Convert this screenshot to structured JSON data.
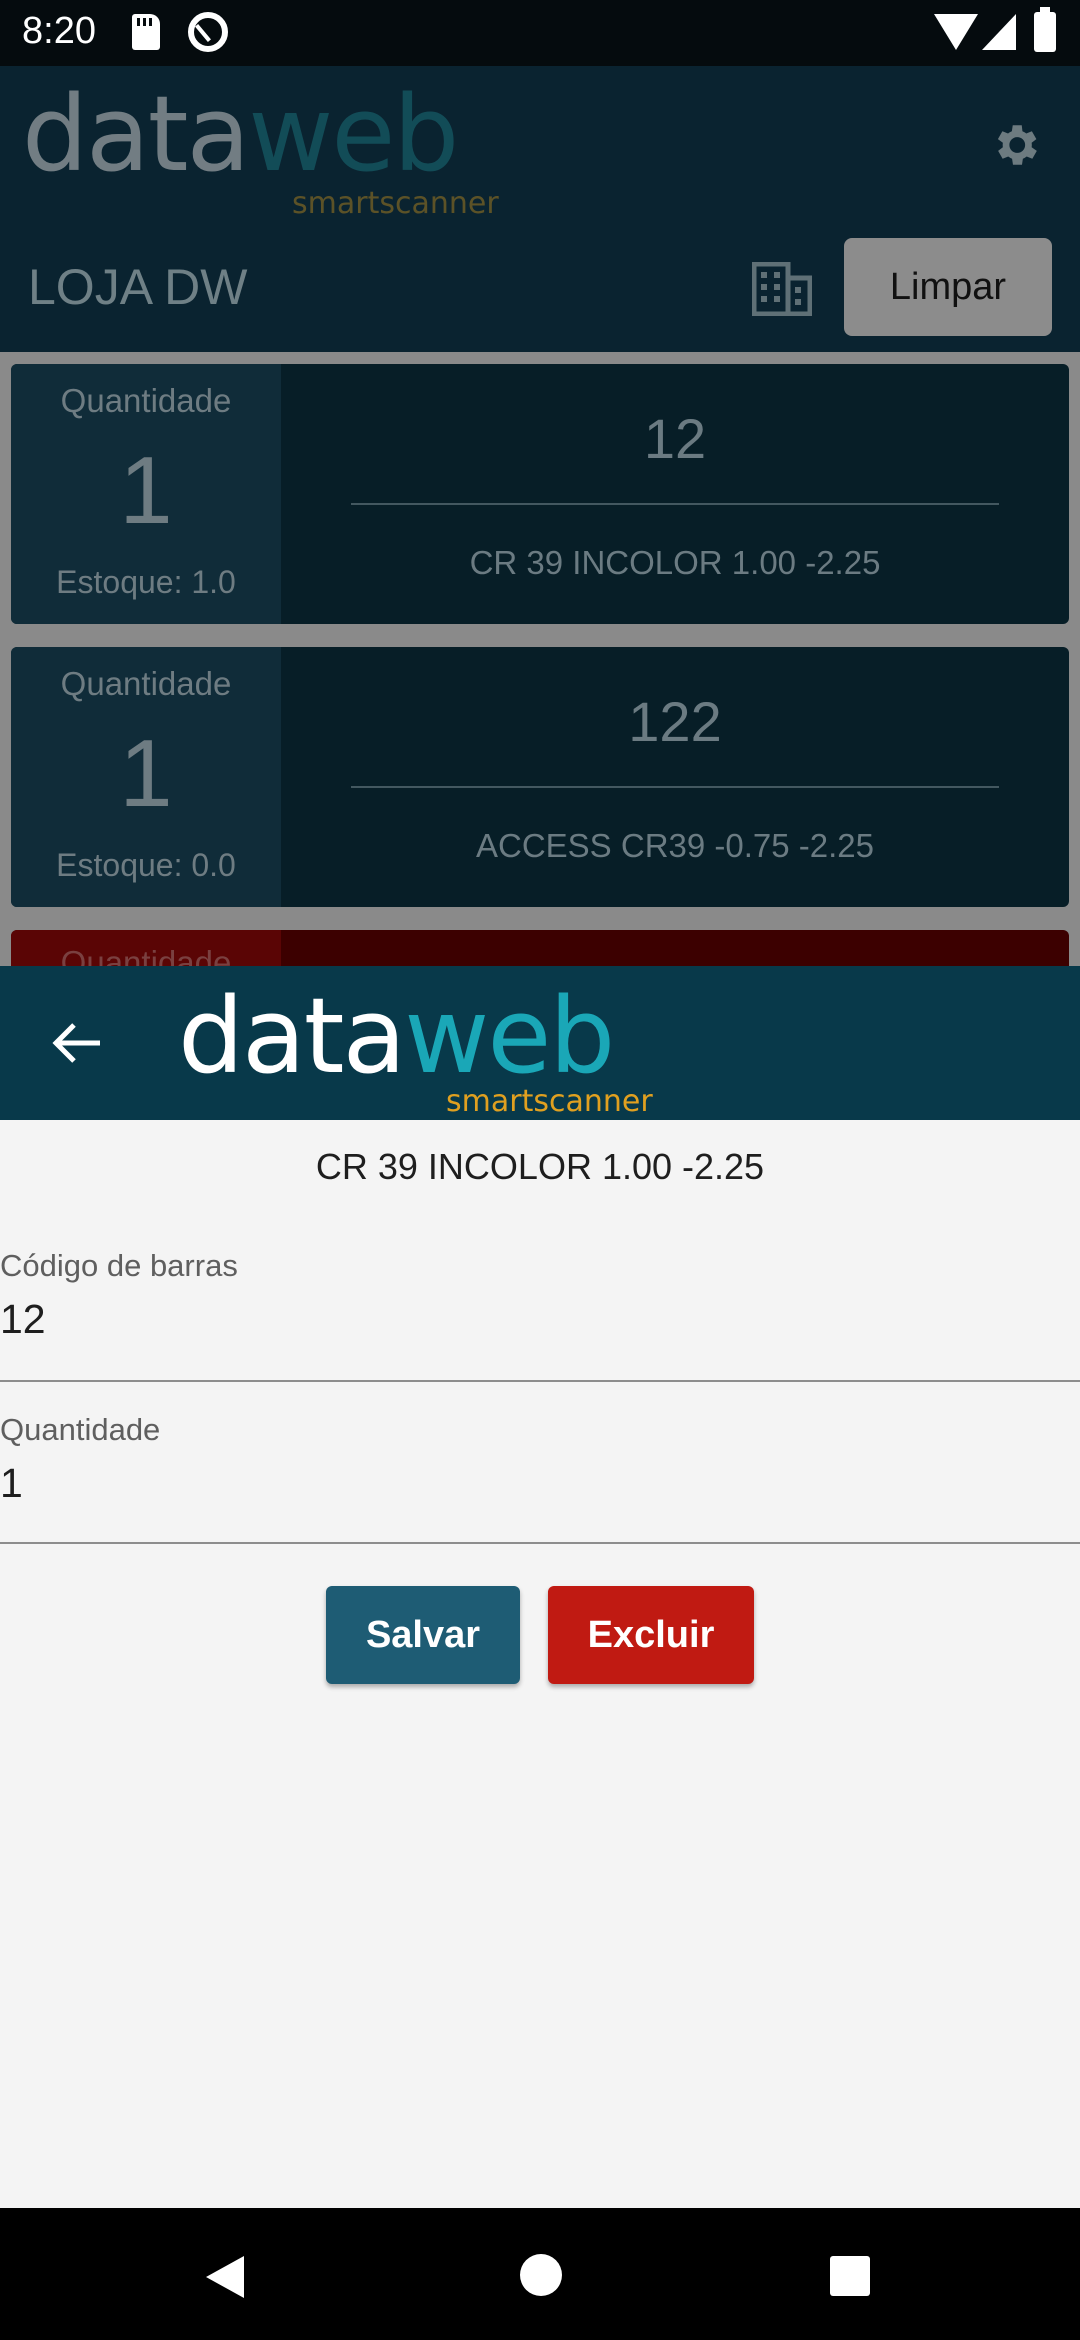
{
  "status_bar": {
    "time": "8:20"
  },
  "brand": {
    "logo_data": "data",
    "logo_web": "web",
    "logo_sub": "smartscanner"
  },
  "background_screen": {
    "store_title": "LOJA DW",
    "clear_label": "Limpar",
    "items": [
      {
        "qty_label": "Quantidade",
        "qty": "1",
        "stock": "Estoque: 1.0",
        "code": "12",
        "description": "CR 39 INCOLOR  1.00 -2.25"
      },
      {
        "qty_label": "Quantidade",
        "qty": "1",
        "stock": "Estoque: 0.0",
        "code": "122",
        "description": "ACCESS CR39 -0.75 -2.25"
      },
      {
        "qty_label": "Quantidade"
      }
    ]
  },
  "detail": {
    "title": "CR 39 INCOLOR  1.00 -2.25",
    "barcode_label": "Código de barras",
    "barcode_value": "12",
    "quantity_label": "Quantidade",
    "quantity_value": "1",
    "save_label": "Salvar",
    "delete_label": "Excluir"
  },
  "colors": {
    "header_bg": "#08394a",
    "save": "#1e5c74",
    "delete": "#c01a12",
    "brand_teal": "#1aa7b7",
    "brand_orange": "#e0a020"
  }
}
